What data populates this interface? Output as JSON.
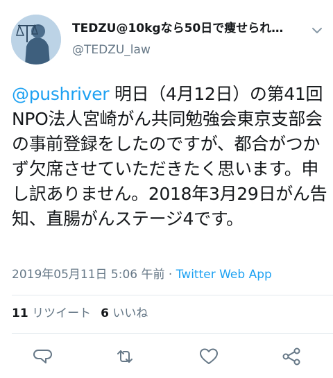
{
  "author": {
    "display_name": "TEDZU@10kgなら50日で痩せられ…",
    "handle": "@TEDZU_law"
  },
  "tweet": {
    "mention": "@pushriver",
    "text": " 明日（4月12日）の第41回NPO法人宮崎がん共同勉強会東京支部会の事前登録をしたのですが、都合がつかず欠席させていただきたく思います。申し訳ありません。2018年3月29日がん告知、直腸がんステージ4です。",
    "timestamp": "2019年05月11日 5:06 午前",
    "separator": " · ",
    "source": "Twitter Web App"
  },
  "stats": {
    "retweet_count": "11",
    "retweet_label": "リツイート",
    "like_count": "6",
    "like_label": "いいね"
  },
  "icons": {
    "menu": "chevron-down-icon",
    "reply": "reply-icon",
    "retweet": "retweet-icon",
    "like": "heart-icon",
    "share": "share-icon"
  },
  "colors": {
    "link": "#1da1f2",
    "secondary_text": "#657786",
    "primary_text": "#14171a",
    "divider": "#e1e8ed"
  }
}
